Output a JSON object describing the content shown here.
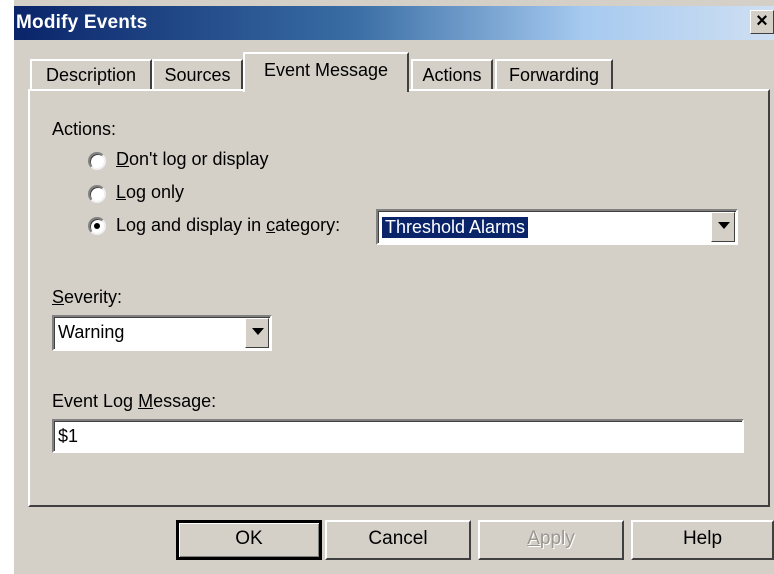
{
  "window": {
    "title": "Modify Events",
    "close_glyph": "×"
  },
  "tabs": [
    {
      "label": "Description",
      "active": false
    },
    {
      "label": "Sources",
      "active": false
    },
    {
      "label": "Event Message",
      "active": true
    },
    {
      "label": "Actions",
      "active": false
    },
    {
      "label": "Forwarding",
      "active": false
    }
  ],
  "actions": {
    "heading": "Actions:",
    "options": [
      {
        "first": "D",
        "rest": "on't log or display",
        "selected": false
      },
      {
        "first": "L",
        "rest": "og only",
        "selected": false
      },
      {
        "pre": "Log and display in ",
        "ul": "c",
        "post": "ategory:",
        "selected": true
      }
    ],
    "category_value": "Threshold Alarms"
  },
  "severity": {
    "label_first": "S",
    "label_rest": "everity:",
    "value": "Warning"
  },
  "event_log": {
    "label_pre": "Event Log ",
    "label_ul": "M",
    "label_post": "essage:",
    "value": "$1"
  },
  "buttons": {
    "ok": "OK",
    "cancel": "Cancel",
    "apply_ul": "A",
    "apply_rest": "pply",
    "help": "Help"
  }
}
